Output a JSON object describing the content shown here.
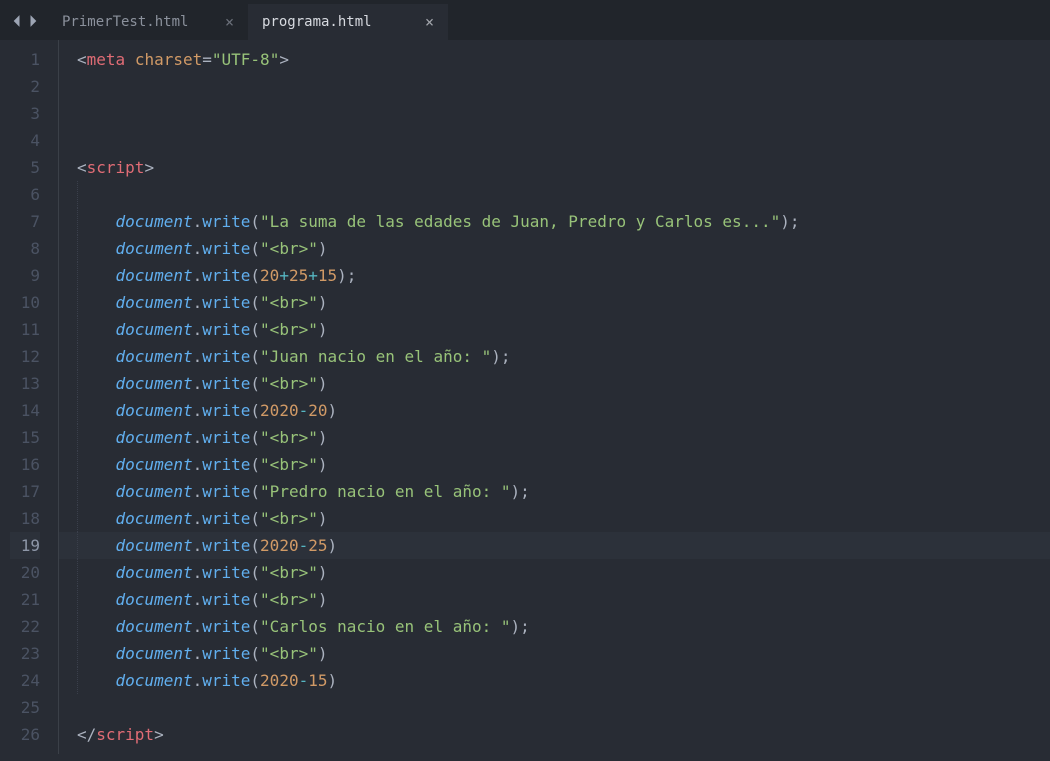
{
  "tabs": [
    {
      "label": "PrimerTest.html",
      "active": false
    },
    {
      "label": "programa.html",
      "active": true
    }
  ],
  "current_line": 19,
  "code_lines": [
    {
      "n": 1,
      "indent": 0,
      "tokens": [
        {
          "t": "punct",
          "v": "<"
        },
        {
          "t": "tagname",
          "v": "meta"
        },
        {
          "t": "punct",
          "v": " "
        },
        {
          "t": "attr",
          "v": "charset"
        },
        {
          "t": "eq",
          "v": "="
        },
        {
          "t": "string",
          "v": "\"UTF-8\""
        },
        {
          "t": "punct",
          "v": ">"
        }
      ]
    },
    {
      "n": 2,
      "indent": 0,
      "tokens": []
    },
    {
      "n": 3,
      "indent": 0,
      "tokens": []
    },
    {
      "n": 4,
      "indent": 0,
      "tokens": []
    },
    {
      "n": 5,
      "indent": 0,
      "tokens": [
        {
          "t": "punct",
          "v": "<"
        },
        {
          "t": "tagname",
          "v": "script"
        },
        {
          "t": "punct",
          "v": ">"
        }
      ]
    },
    {
      "n": 6,
      "indent": 1,
      "tokens": []
    },
    {
      "n": 7,
      "indent": 1,
      "tokens": [
        {
          "t": "obj italic",
          "v": "document"
        },
        {
          "t": "punct",
          "v": "."
        },
        {
          "t": "func",
          "v": "write"
        },
        {
          "t": "punct",
          "v": "("
        },
        {
          "t": "string",
          "v": "\"La suma de las edades de Juan, Predro y Carlos es...\""
        },
        {
          "t": "punct",
          "v": ")"
        },
        {
          "t": "semic",
          "v": ";"
        }
      ]
    },
    {
      "n": 8,
      "indent": 1,
      "tokens": [
        {
          "t": "obj italic",
          "v": "document"
        },
        {
          "t": "punct",
          "v": "."
        },
        {
          "t": "func",
          "v": "write"
        },
        {
          "t": "punct",
          "v": "("
        },
        {
          "t": "string",
          "v": "\"<br>\""
        },
        {
          "t": "punct",
          "v": ")"
        }
      ]
    },
    {
      "n": 9,
      "indent": 1,
      "tokens": [
        {
          "t": "obj italic",
          "v": "document"
        },
        {
          "t": "punct",
          "v": "."
        },
        {
          "t": "func",
          "v": "write"
        },
        {
          "t": "punct",
          "v": "("
        },
        {
          "t": "num",
          "v": "20"
        },
        {
          "t": "op",
          "v": "+"
        },
        {
          "t": "num",
          "v": "25"
        },
        {
          "t": "op",
          "v": "+"
        },
        {
          "t": "num",
          "v": "15"
        },
        {
          "t": "punct",
          "v": ")"
        },
        {
          "t": "semic",
          "v": ";"
        }
      ]
    },
    {
      "n": 10,
      "indent": 1,
      "tokens": [
        {
          "t": "obj italic",
          "v": "document"
        },
        {
          "t": "punct",
          "v": "."
        },
        {
          "t": "func",
          "v": "write"
        },
        {
          "t": "punct",
          "v": "("
        },
        {
          "t": "string",
          "v": "\"<br>\""
        },
        {
          "t": "punct",
          "v": ")"
        }
      ]
    },
    {
      "n": 11,
      "indent": 1,
      "tokens": [
        {
          "t": "obj italic",
          "v": "document"
        },
        {
          "t": "punct",
          "v": "."
        },
        {
          "t": "func",
          "v": "write"
        },
        {
          "t": "punct",
          "v": "("
        },
        {
          "t": "string",
          "v": "\"<br>\""
        },
        {
          "t": "punct",
          "v": ")"
        }
      ]
    },
    {
      "n": 12,
      "indent": 1,
      "tokens": [
        {
          "t": "obj italic",
          "v": "document"
        },
        {
          "t": "punct",
          "v": "."
        },
        {
          "t": "func",
          "v": "write"
        },
        {
          "t": "punct",
          "v": "("
        },
        {
          "t": "string",
          "v": "\"Juan nacio en el año: \""
        },
        {
          "t": "punct",
          "v": ")"
        },
        {
          "t": "semic",
          "v": ";"
        }
      ]
    },
    {
      "n": 13,
      "indent": 1,
      "tokens": [
        {
          "t": "obj italic",
          "v": "document"
        },
        {
          "t": "punct",
          "v": "."
        },
        {
          "t": "func",
          "v": "write"
        },
        {
          "t": "punct",
          "v": "("
        },
        {
          "t": "string",
          "v": "\"<br>\""
        },
        {
          "t": "punct",
          "v": ")"
        }
      ]
    },
    {
      "n": 14,
      "indent": 1,
      "tokens": [
        {
          "t": "obj italic",
          "v": "document"
        },
        {
          "t": "punct",
          "v": "."
        },
        {
          "t": "func",
          "v": "write"
        },
        {
          "t": "punct",
          "v": "("
        },
        {
          "t": "num",
          "v": "2020"
        },
        {
          "t": "op",
          "v": "-"
        },
        {
          "t": "num",
          "v": "20"
        },
        {
          "t": "punct",
          "v": ")"
        }
      ]
    },
    {
      "n": 15,
      "indent": 1,
      "tokens": [
        {
          "t": "obj italic",
          "v": "document"
        },
        {
          "t": "punct",
          "v": "."
        },
        {
          "t": "func",
          "v": "write"
        },
        {
          "t": "punct",
          "v": "("
        },
        {
          "t": "string",
          "v": "\"<br>\""
        },
        {
          "t": "punct",
          "v": ")"
        }
      ]
    },
    {
      "n": 16,
      "indent": 1,
      "tokens": [
        {
          "t": "obj italic",
          "v": "document"
        },
        {
          "t": "punct",
          "v": "."
        },
        {
          "t": "func",
          "v": "write"
        },
        {
          "t": "punct",
          "v": "("
        },
        {
          "t": "string",
          "v": "\"<br>\""
        },
        {
          "t": "punct",
          "v": ")"
        }
      ]
    },
    {
      "n": 17,
      "indent": 1,
      "tokens": [
        {
          "t": "obj italic",
          "v": "document"
        },
        {
          "t": "punct",
          "v": "."
        },
        {
          "t": "func",
          "v": "write"
        },
        {
          "t": "punct",
          "v": "("
        },
        {
          "t": "string",
          "v": "\"Predro nacio en el año: \""
        },
        {
          "t": "punct",
          "v": ")"
        },
        {
          "t": "semic",
          "v": ";"
        }
      ]
    },
    {
      "n": 18,
      "indent": 1,
      "tokens": [
        {
          "t": "obj italic",
          "v": "document"
        },
        {
          "t": "punct",
          "v": "."
        },
        {
          "t": "func",
          "v": "write"
        },
        {
          "t": "punct",
          "v": "("
        },
        {
          "t": "string",
          "v": "\"<br>\""
        },
        {
          "t": "punct",
          "v": ")"
        }
      ]
    },
    {
      "n": 19,
      "indent": 1,
      "tokens": [
        {
          "t": "obj italic",
          "v": "document"
        },
        {
          "t": "punct",
          "v": "."
        },
        {
          "t": "func",
          "v": "write"
        },
        {
          "t": "punct",
          "v": "("
        },
        {
          "t": "num",
          "v": "2020"
        },
        {
          "t": "op",
          "v": "-"
        },
        {
          "t": "num",
          "v": "25"
        },
        {
          "t": "punct",
          "v": ")"
        }
      ]
    },
    {
      "n": 20,
      "indent": 1,
      "tokens": [
        {
          "t": "obj italic",
          "v": "document"
        },
        {
          "t": "punct",
          "v": "."
        },
        {
          "t": "func",
          "v": "write"
        },
        {
          "t": "punct",
          "v": "("
        },
        {
          "t": "string",
          "v": "\"<br>\""
        },
        {
          "t": "punct",
          "v": ")"
        }
      ]
    },
    {
      "n": 21,
      "indent": 1,
      "tokens": [
        {
          "t": "obj italic",
          "v": "document"
        },
        {
          "t": "punct",
          "v": "."
        },
        {
          "t": "func",
          "v": "write"
        },
        {
          "t": "punct",
          "v": "("
        },
        {
          "t": "string",
          "v": "\"<br>\""
        },
        {
          "t": "punct",
          "v": ")"
        }
      ]
    },
    {
      "n": 22,
      "indent": 1,
      "tokens": [
        {
          "t": "obj italic",
          "v": "document"
        },
        {
          "t": "punct",
          "v": "."
        },
        {
          "t": "func",
          "v": "write"
        },
        {
          "t": "punct",
          "v": "("
        },
        {
          "t": "string",
          "v": "\"Carlos nacio en el año: \""
        },
        {
          "t": "punct",
          "v": ")"
        },
        {
          "t": "semic",
          "v": ";"
        }
      ]
    },
    {
      "n": 23,
      "indent": 1,
      "tokens": [
        {
          "t": "obj italic",
          "v": "document"
        },
        {
          "t": "punct",
          "v": "."
        },
        {
          "t": "func",
          "v": "write"
        },
        {
          "t": "punct",
          "v": "("
        },
        {
          "t": "string",
          "v": "\"<br>\""
        },
        {
          "t": "punct",
          "v": ")"
        }
      ]
    },
    {
      "n": 24,
      "indent": 1,
      "tokens": [
        {
          "t": "obj italic",
          "v": "document"
        },
        {
          "t": "punct",
          "v": "."
        },
        {
          "t": "func",
          "v": "write"
        },
        {
          "t": "punct",
          "v": "("
        },
        {
          "t": "num",
          "v": "2020"
        },
        {
          "t": "op",
          "v": "-"
        },
        {
          "t": "num",
          "v": "15"
        },
        {
          "t": "punct",
          "v": ")"
        }
      ]
    },
    {
      "n": 25,
      "indent": 0,
      "tokens": []
    },
    {
      "n": 26,
      "indent": 0,
      "tokens": [
        {
          "t": "punct",
          "v": "</"
        },
        {
          "t": "tagname",
          "v": "script"
        },
        {
          "t": "punct",
          "v": ">"
        }
      ]
    }
  ]
}
